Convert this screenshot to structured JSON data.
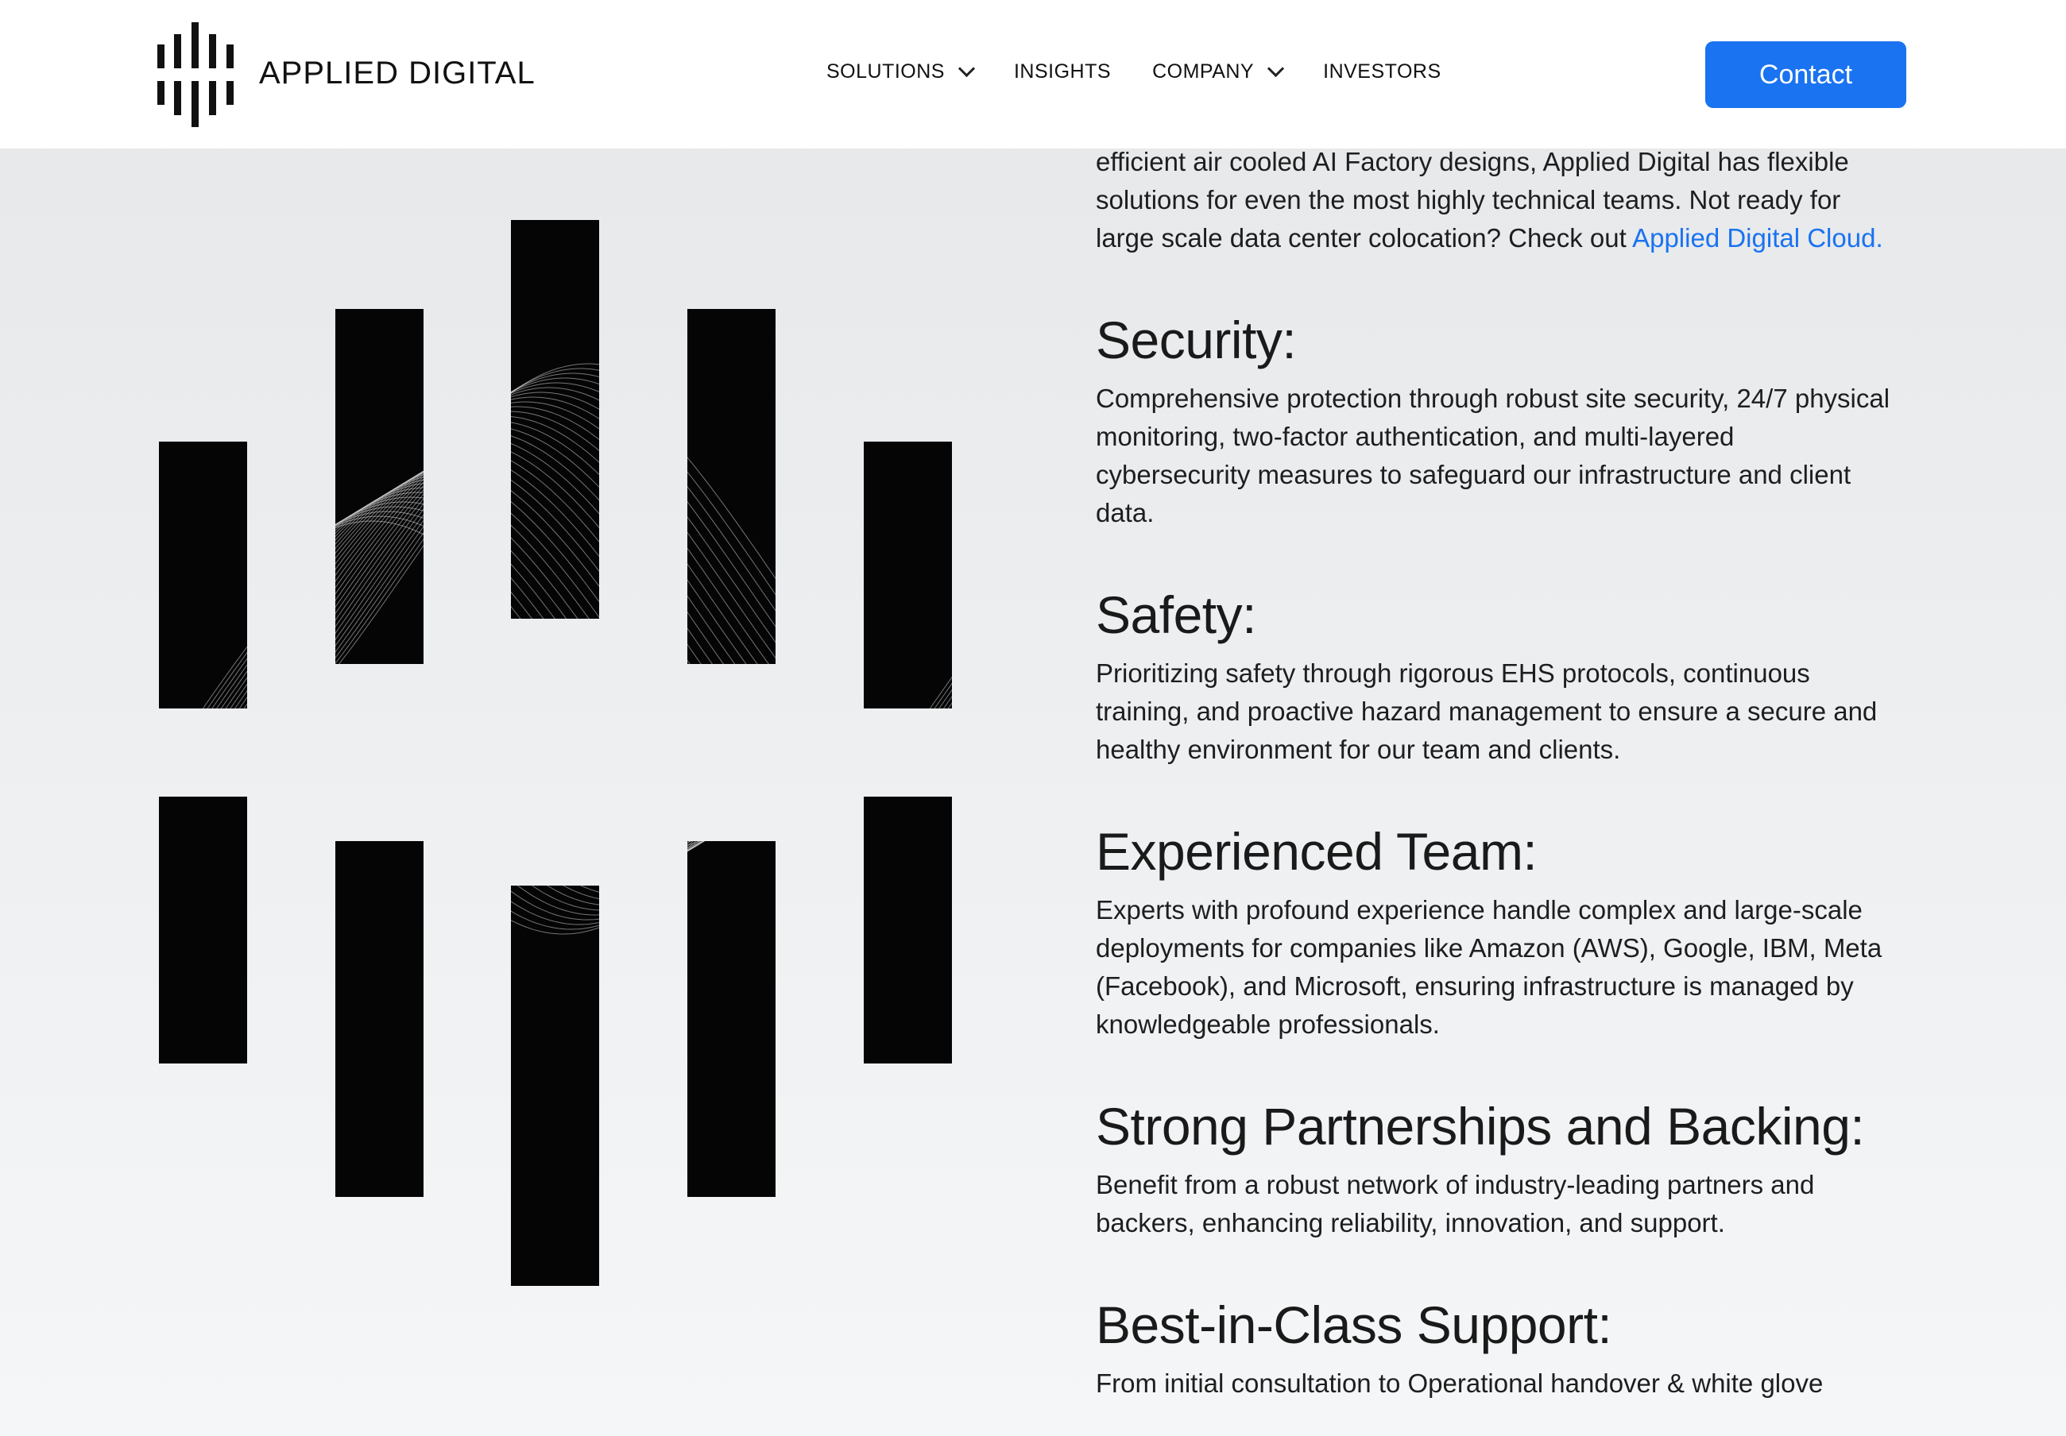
{
  "header": {
    "brand": "APPLIED DIGITAL",
    "nav": [
      {
        "label": "SOLUTIONS",
        "has_dropdown": true
      },
      {
        "label": "INSIGHTS",
        "has_dropdown": false
      },
      {
        "label": "COMPANY",
        "has_dropdown": true
      },
      {
        "label": "INVESTORS",
        "has_dropdown": false
      }
    ],
    "contact_label": "Contact"
  },
  "intro": {
    "lines": [
      "efficient air cooled AI Factory designs, Applied Digital has flexible",
      "solutions for even the most highly technical teams. Not ready for",
      "large scale data center colocation? Check out "
    ],
    "link_text": "Applied Digital Cloud."
  },
  "sections": [
    {
      "title": "Security:",
      "lines": [
        "Comprehensive protection through robust site security, 24/7 physical",
        "monitoring, two-factor authentication, and multi-layered",
        "cybersecurity measures to safeguard our infrastructure and client",
        "data."
      ]
    },
    {
      "title": "Safety:",
      "lines": [
        "Prioritizing safety through rigorous EHS protocols, continuous",
        "training, and proactive hazard management to ensure a secure and",
        "healthy environment for our team and clients."
      ]
    },
    {
      "title": "Experienced Team:",
      "lines": [
        "Experts with profound experience handle complex and large-scale",
        "deployments for companies like Amazon (AWS), Google, IBM, Meta",
        "(Facebook), and Microsoft, ensuring infrastructure is managed by",
        "knowledgeable professionals."
      ]
    },
    {
      "title": "Strong Partnerships and Backing:",
      "lines": [
        "Benefit from a robust network of industry-leading partners and",
        "backers, enhancing reliability, innovation, and support."
      ]
    },
    {
      "title": "Best-in-Class Support:",
      "lines": [
        "From initial consultation to Operational handover & white glove"
      ]
    }
  ],
  "colors": {
    "accent": "#1a73f0",
    "bar": "#050505",
    "text": "#1e1e1e"
  }
}
